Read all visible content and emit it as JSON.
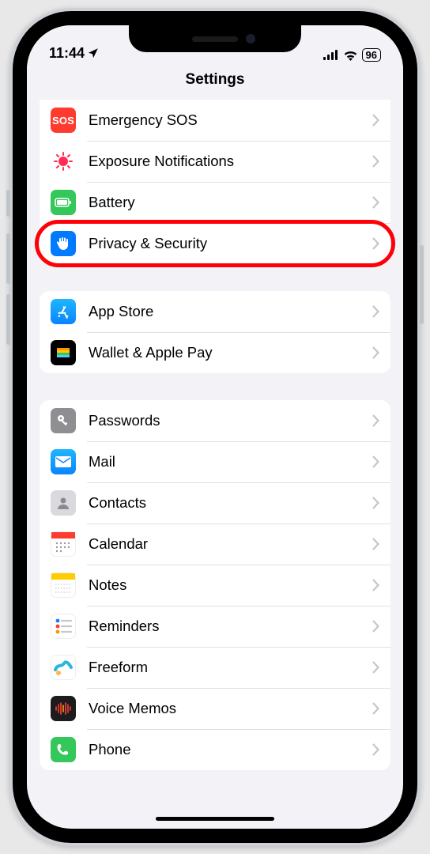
{
  "status": {
    "time": "11:44",
    "battery": "96"
  },
  "header": {
    "title": "Settings"
  },
  "groups": [
    {
      "id": "core",
      "items": [
        {
          "id": "sos",
          "label": "Emergency SOS"
        },
        {
          "id": "exposure",
          "label": "Exposure Notifications"
        },
        {
          "id": "battery",
          "label": "Battery"
        },
        {
          "id": "privacy",
          "label": "Privacy & Security",
          "highlight": true
        }
      ]
    },
    {
      "id": "store",
      "items": [
        {
          "id": "appstore",
          "label": "App Store"
        },
        {
          "id": "wallet",
          "label": "Wallet & Apple Pay"
        }
      ]
    },
    {
      "id": "apps",
      "items": [
        {
          "id": "passwords",
          "label": "Passwords"
        },
        {
          "id": "mail",
          "label": "Mail"
        },
        {
          "id": "contacts",
          "label": "Contacts"
        },
        {
          "id": "calendar",
          "label": "Calendar"
        },
        {
          "id": "notes",
          "label": "Notes"
        },
        {
          "id": "reminders",
          "label": "Reminders"
        },
        {
          "id": "freeform",
          "label": "Freeform"
        },
        {
          "id": "voicememos",
          "label": "Voice Memos"
        },
        {
          "id": "phone",
          "label": "Phone"
        }
      ]
    }
  ]
}
